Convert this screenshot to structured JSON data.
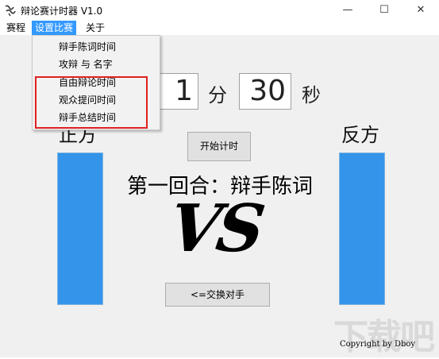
{
  "window": {
    "title": "辩论赛计时器 V1.0",
    "minimize_glyph": "—",
    "maximize_glyph": "☐",
    "close_glyph": "✕"
  },
  "menubar": {
    "items": [
      "赛程",
      "设置比赛",
      "关于"
    ]
  },
  "dropdown": {
    "items": [
      "辩手陈词时间",
      "攻辩 与 名字",
      "自由辩论时间",
      "观众提问时间",
      "辩手总结时间"
    ]
  },
  "timer": {
    "minutes": "1",
    "minutes_unit": "分",
    "seconds": "30",
    "seconds_unit": "秒"
  },
  "sides": {
    "left": "正方",
    "right": "反方"
  },
  "controls": {
    "start_label": "开始计时",
    "swap_label": "<=交换对手"
  },
  "round_text": "第一回合：辩手陈词",
  "vs_text": "VS",
  "copyright": "Copyright by Dboy",
  "watermark": "下载吧",
  "colors": {
    "bar": "#3394ea",
    "menu_active": "#3399ff",
    "highlight": "#e02020"
  }
}
